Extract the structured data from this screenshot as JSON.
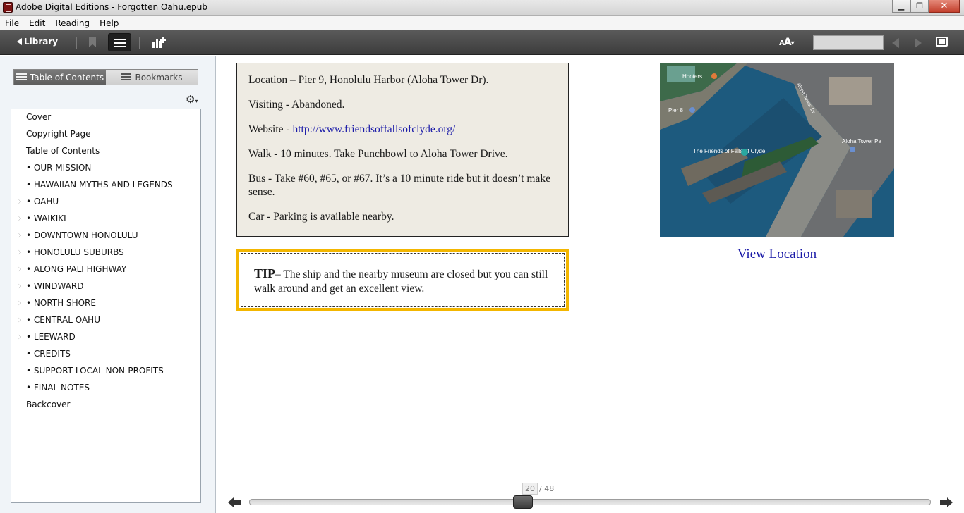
{
  "window": {
    "title": "Adobe Digital Editions - Forgotten Oahu.epub",
    "controls": {
      "minimize": "▁",
      "maximize": "❐",
      "close": "✕"
    }
  },
  "menu": {
    "items": [
      "File",
      "Edit",
      "Reading",
      "Help"
    ]
  },
  "toolbar": {
    "library_label": "Library",
    "font_label_big": "A",
    "font_label_small": "A",
    "search_value": ""
  },
  "sidebar": {
    "tabs": {
      "toc": "Table of Contents",
      "bookmarks": "Bookmarks"
    },
    "toc_items": [
      {
        "label": "Cover",
        "expandable": false
      },
      {
        "label": "Copyright Page",
        "expandable": false
      },
      {
        "label": "Table of Contents",
        "expandable": false
      },
      {
        "label": "• OUR MISSION",
        "expandable": false
      },
      {
        "label": "• HAWAIIAN MYTHS AND LEGENDS",
        "expandable": false
      },
      {
        "label": "• OAHU",
        "expandable": true
      },
      {
        "label": "• WAIKIKI",
        "expandable": true
      },
      {
        "label": "• DOWNTOWN HONOLULU",
        "expandable": true
      },
      {
        "label": "• HONOLULU SUBURBS",
        "expandable": true
      },
      {
        "label": "• ALONG PALI HIGHWAY",
        "expandable": true
      },
      {
        "label": "• WINDWARD",
        "expandable": true
      },
      {
        "label": "• NORTH SHORE",
        "expandable": true
      },
      {
        "label": "• CENTRAL OAHU",
        "expandable": true
      },
      {
        "label": "• LEEWARD",
        "expandable": true
      },
      {
        "label": "• CREDITS",
        "expandable": false
      },
      {
        "label": "• SUPPORT LOCAL NON-PROFITS",
        "expandable": false
      },
      {
        "label": "• FINAL NOTES",
        "expandable": false
      },
      {
        "label": "Backcover",
        "expandable": false
      }
    ]
  },
  "content": {
    "info": {
      "location": "Location – Pier 9, Honolulu Harbor (Aloha Tower Dr).",
      "visiting": "Visiting - Abandoned.",
      "website_prefix": "Website - ",
      "website_link": "http://www.friendsoffallsofclyde.org/",
      "walk": "Walk - 10 minutes. Take Punchbowl to Aloha Tower Drive.",
      "bus": "Bus - Take #60, #65, or #67. It’s a 10 minute ride but it doesn’t make sense.",
      "car": "Car - Parking is available nearby."
    },
    "tip": {
      "label": "TIP",
      "text": "– The ship and the nearby museum are closed but you can still walk around and get an excellent view."
    },
    "map": {
      "labels": {
        "hooters": "Hooters",
        "pier8": "Pier 8",
        "friends": "The Friends of Falls of Clyde",
        "aloha_tower_dr": "Aloha Tower Dr",
        "aloha_tower": "Aloha Tower Pa"
      }
    },
    "view_location": "View Location"
  },
  "pager": {
    "current": "20",
    "total": "/ 48",
    "progress_fraction": 0.4
  },
  "colors": {
    "toolbar": "#4a4a4a",
    "link": "#1a1aa8",
    "tip_border": "#f3b600",
    "infobox_bg": "#eeebe3"
  }
}
